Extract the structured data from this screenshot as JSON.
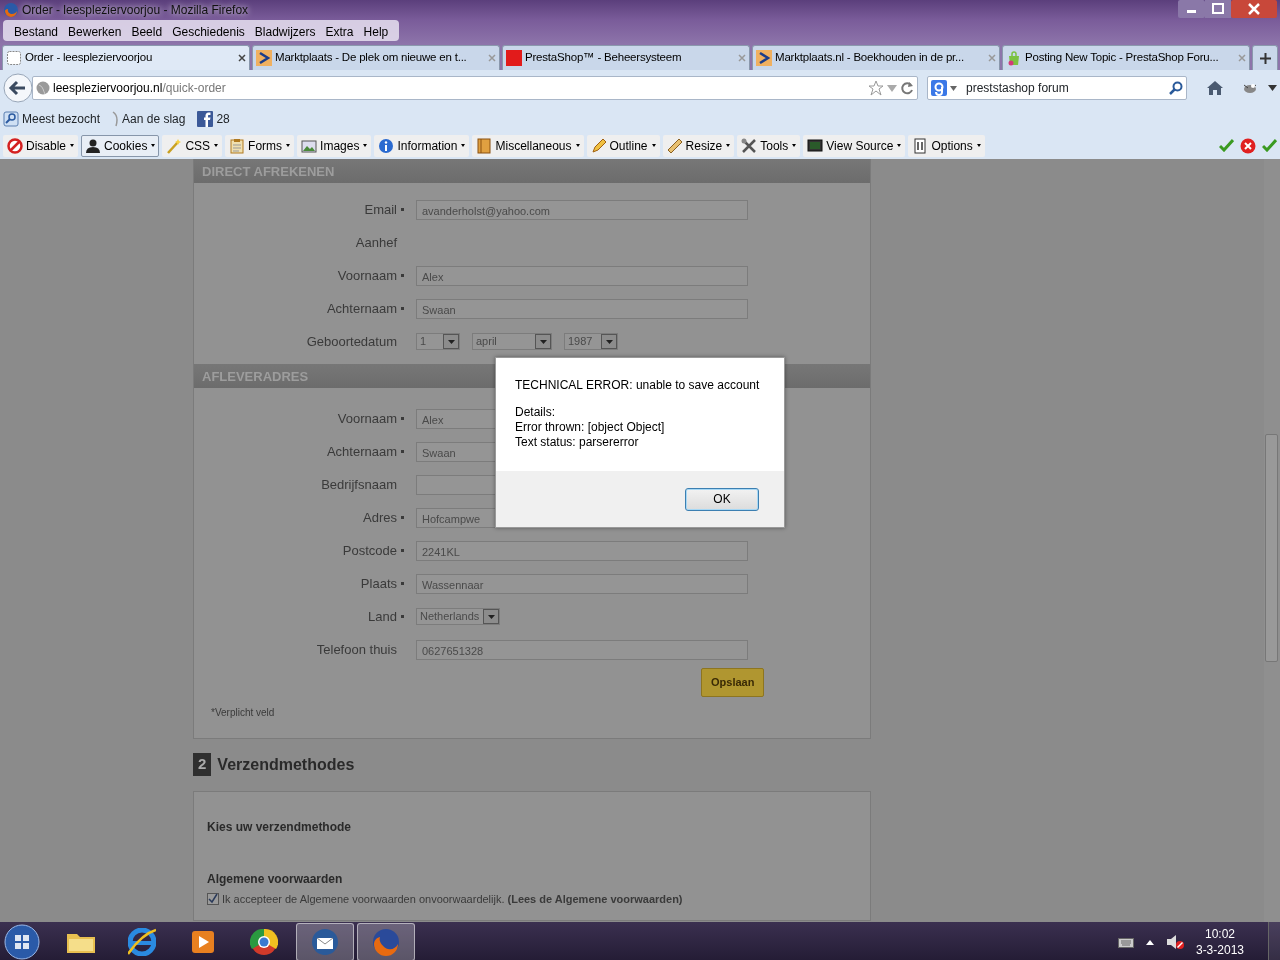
{
  "window": {
    "title": "Order - leespleziervoorjou - Mozilla Firefox"
  },
  "menu": [
    "Bestand",
    "Bewerken",
    "Beeld",
    "Geschiedenis",
    "Bladwijzers",
    "Extra",
    "Help"
  ],
  "tabs": [
    {
      "label": "Order - leespleziervoorjou",
      "kind": "empty",
      "selected": true
    },
    {
      "label": "Marktplaats - De plek om nieuwe en t...",
      "kind": "chevron",
      "selected": false
    },
    {
      "label": "PrestaShop™ - Beheersysteem",
      "kind": "square",
      "selected": false
    },
    {
      "label": "Marktplaats.nl - Boekhouden in de pr...",
      "kind": "chevron",
      "selected": false
    },
    {
      "label": "Posting New Topic - PrestaShop Foru...",
      "kind": "bag",
      "selected": false
    }
  ],
  "address": {
    "domain": "leespleziervoorjou.nl",
    "path": "/quick-order"
  },
  "search": {
    "value": "preststashop forum"
  },
  "bookmarks": [
    {
      "label": "Meest bezocht",
      "kind": "magnifier"
    },
    {
      "label": "Aan de slag",
      "kind": "leaf"
    },
    {
      "label": "28",
      "kind": "social"
    }
  ],
  "devtools": [
    {
      "label": "Disable",
      "kind": "disable",
      "pressed": false
    },
    {
      "label": "Cookies",
      "kind": "person",
      "pressed": true
    },
    {
      "label": "CSS",
      "kind": "wand",
      "pressed": false
    },
    {
      "label": "Forms",
      "kind": "clipboard",
      "pressed": false
    },
    {
      "label": "Images",
      "kind": "image",
      "pressed": false
    },
    {
      "label": "Information",
      "kind": "info",
      "pressed": false
    },
    {
      "label": "Miscellaneous",
      "kind": "book",
      "pressed": false
    },
    {
      "label": "Outline",
      "kind": "pencil",
      "pressed": false
    },
    {
      "label": "Resize",
      "kind": "ruler",
      "pressed": false
    },
    {
      "label": "Tools",
      "kind": "tools",
      "pressed": false
    },
    {
      "label": "View Source",
      "kind": "monitor",
      "pressed": false
    },
    {
      "label": "Options",
      "kind": "document",
      "pressed": false
    }
  ],
  "sections": [
    {
      "title": "DIRECT AFREKENEN",
      "fields": [
        {
          "label": "Email",
          "required": true,
          "kind": "text",
          "value": "avanderholst@yahoo.com"
        },
        {
          "label": "Aanhef",
          "required": false,
          "kind": "label"
        },
        {
          "label": "Voornaam",
          "required": true,
          "kind": "text",
          "value": "Alex"
        },
        {
          "label": "Achternaam",
          "required": true,
          "kind": "text",
          "value": "Swaan"
        },
        {
          "label": "Geboortedatum",
          "required": false,
          "kind": "date",
          "values": [
            "1",
            "april",
            "1987"
          ]
        }
      ]
    },
    {
      "title": "AFLEVERADRES",
      "fields": [
        {
          "label": "Voornaam",
          "required": true,
          "kind": "text",
          "value": "Alex"
        },
        {
          "label": "Achternaam",
          "required": true,
          "kind": "text",
          "value": "Swaan"
        },
        {
          "label": "Bedrijfsnaam",
          "required": false,
          "kind": "text"
        },
        {
          "label": "Adres",
          "required": true,
          "kind": "text",
          "value": "Hofcampwe"
        },
        {
          "label": "Postcode",
          "required": true,
          "kind": "text",
          "value": "2241KL"
        },
        {
          "label": "Plaats",
          "required": true,
          "kind": "text",
          "value": "Wassennaar"
        },
        {
          "label": "Land",
          "required": true,
          "kind": "select",
          "value": "Netherlands"
        },
        {
          "label": "Telefoon thuis",
          "required": false,
          "kind": "text",
          "value": "0627651328"
        }
      ]
    }
  ],
  "save_button": "Opslaan",
  "required_note": "*Verplicht veld",
  "step": {
    "number": "2",
    "title": "Verzendmethodes"
  },
  "shipping": {
    "heading": "Kies uw verzendmethode",
    "terms_heading": "Algemene voorwaarden",
    "terms_checked": true,
    "terms_text": "Ik accepteer de Algemene voorwaarden onvoorwaardelijk.",
    "terms_link": "(Lees de Algemene voorwaarden)"
  },
  "dialog": {
    "title": "TECHNICAL ERROR: unable to save account",
    "details": [
      "Details:",
      "Error thrown: [object Object]",
      "Text status: parsererror"
    ],
    "button": "OK"
  },
  "taskbar": {
    "apps": [
      {
        "kind": "folder",
        "active": false
      },
      {
        "kind": "globe",
        "active": false
      },
      {
        "kind": "player",
        "active": false
      },
      {
        "kind": "wheel",
        "active": false
      },
      {
        "kind": "mail",
        "active": true
      },
      {
        "kind": "fox",
        "active": true
      }
    ],
    "time": "10:02",
    "date": "3-3-2013"
  }
}
